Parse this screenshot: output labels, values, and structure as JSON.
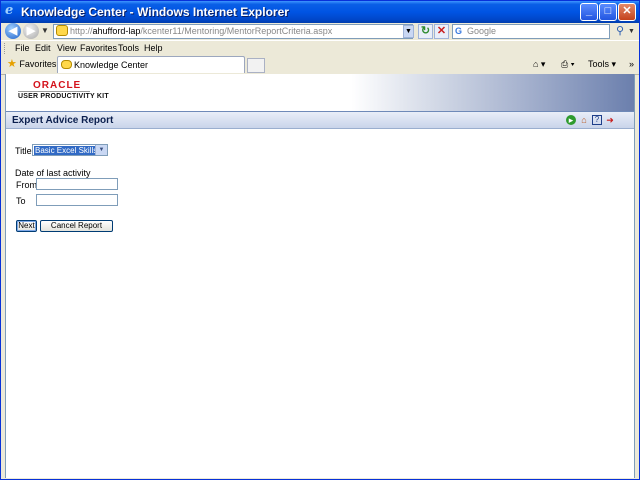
{
  "window": {
    "title": "Knowledge Center - Windows Internet Explorer",
    "buttons": {
      "minimize": "_",
      "maximize": "□",
      "close": "✕"
    }
  },
  "address_bar": {
    "prefix": "http://",
    "host": "ahufford-lap",
    "path": "/kcenter11/Mentoring/MentorReportCriteria.aspx"
  },
  "search": {
    "placeholder": "Google"
  },
  "menu": [
    "File",
    "Edit",
    "View",
    "Favorites",
    "Tools",
    "Help"
  ],
  "favorites_label": "Favorites",
  "tab": {
    "label": "Knowledge Center"
  },
  "command_bar": {
    "tools_label": "Tools ▾"
  },
  "header": {
    "logo_brand": "ORACLE",
    "logo_product": "USER PRODUCTIVITY KIT"
  },
  "report": {
    "title": "Expert Advice Report",
    "icons": [
      "go-icon",
      "home-icon",
      "help-icon",
      "exit-icon"
    ]
  },
  "form": {
    "title_label": "Title",
    "title_value": "Basic Excel Skills",
    "date_label": "Date of last activity",
    "from_label": "From",
    "to_label": "To",
    "from_value": "",
    "to_value": "",
    "next_label": "Next",
    "cancel_label": "Cancel Report"
  },
  "colors": {
    "title_bar": "#0054e3",
    "oracle_red": "#d4121b",
    "selection": "#316ac5"
  }
}
